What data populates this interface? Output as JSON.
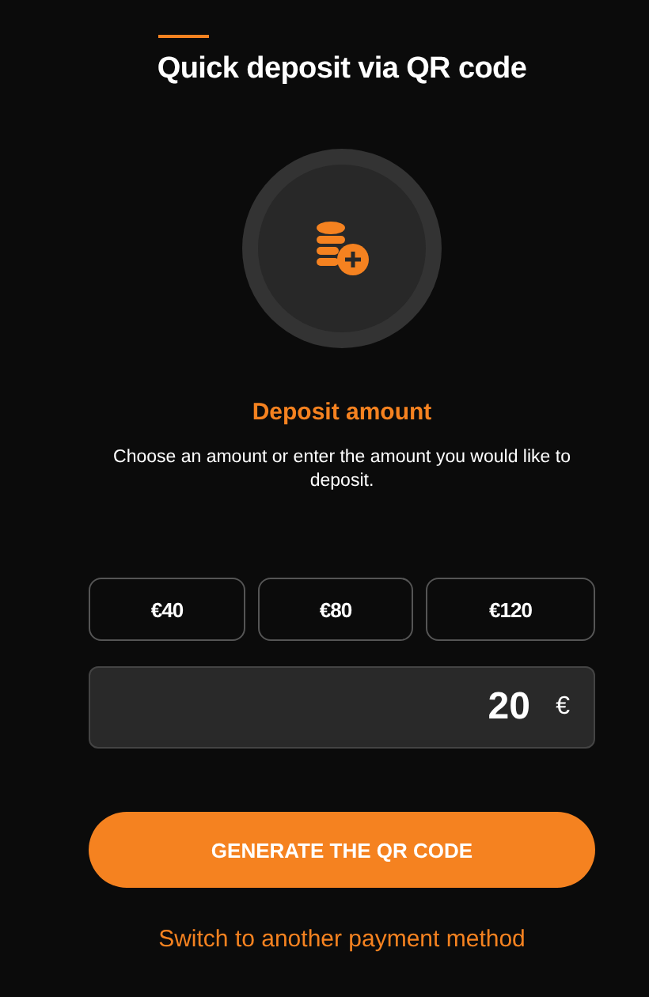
{
  "title": "Quick deposit via QR code",
  "section_title": "Deposit amount",
  "description": "Choose an amount or enter the amount you would like to deposit.",
  "presets": [
    {
      "label": "€40"
    },
    {
      "label": "€80"
    },
    {
      "label": "€120"
    }
  ],
  "amount_field": {
    "value": "20",
    "currency": "€"
  },
  "primary_button": "GENERATE THE QR CODE",
  "secondary_link": "Switch to another payment method"
}
